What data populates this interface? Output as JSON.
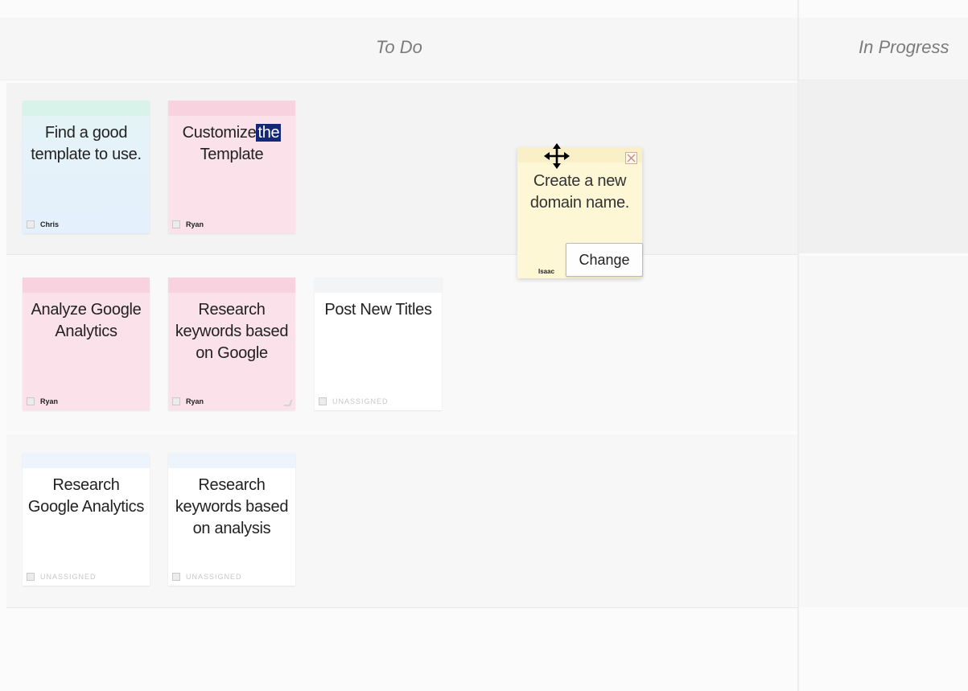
{
  "columns": {
    "todo": "To Do",
    "in_progress": "In Progress"
  },
  "cards": [
    {
      "text": "Find a good template to use.",
      "owner": "Chris",
      "color": "#e4f0fb"
    },
    {
      "text_before": "Customize",
      "text_selected": "the",
      "text_after": "Template",
      "owner": "Ryan",
      "color": "#fbe1ea"
    },
    {
      "text": "Create a new domain name.",
      "owner": "Isaac",
      "color": "#fdf7d6",
      "action": "Change"
    },
    {
      "text": "Analyze Google Analytics",
      "owner": "Ryan",
      "color": "#fbe1ea"
    },
    {
      "text": "Research keywords based on Google",
      "owner": "Ryan",
      "color": "#fbe1ea"
    },
    {
      "text": "Post New Titles",
      "owner": "UNASSIGNED",
      "color": "#ffffff"
    },
    {
      "text": "Research Google Analytics",
      "owner": "UNASSIGNED",
      "color": "#ffffff"
    },
    {
      "text": "Research keywords based on analysis",
      "owner": "UNASSIGNED",
      "color": "#ffffff"
    }
  ],
  "icons": {
    "drag": "move-icon",
    "close": "close-icon",
    "resize": "resize-grip-icon"
  }
}
